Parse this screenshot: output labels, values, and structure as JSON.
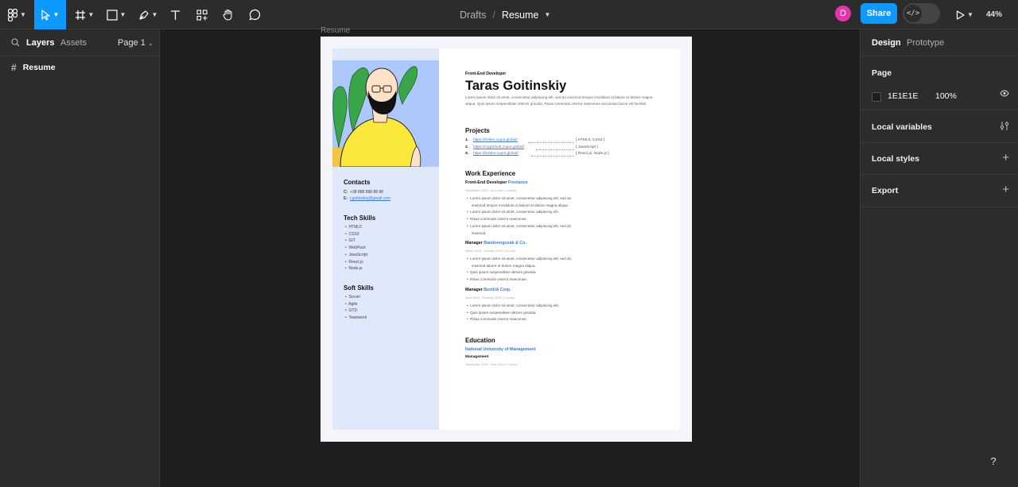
{
  "toolbar": {
    "breadcrumb_folder": "Drafts",
    "breadcrumb_sep": "/",
    "file_name": "Resume",
    "avatar_letter": "D",
    "share_label": "Share",
    "dev_mode_icon": "</>",
    "zoom": "44%"
  },
  "left_panel": {
    "tab_layers": "Layers",
    "tab_assets": "Assets",
    "page_selector": "Page 1",
    "layers": [
      {
        "name": "Resume",
        "icon": "frame-icon"
      }
    ]
  },
  "right_panel": {
    "tab_design": "Design",
    "tab_prototype": "Prototype",
    "page_heading": "Page",
    "page_color": "1E1E1E",
    "page_opacity": "100%",
    "local_variables": "Local variables",
    "local_styles": "Local styles",
    "export": "Export"
  },
  "canvas": {
    "frame_label": "Resume"
  },
  "resume": {
    "contacts": {
      "heading": "Contacts",
      "phone_label": "C:",
      "phone": "+38 888 888 88 88",
      "email_label": "E:",
      "email": "t.goitinskiy@gmail.com"
    },
    "tech_skills": {
      "heading": "Tech Skills",
      "items": [
        "HTML5",
        "CSS3",
        "GIT",
        "WebPack",
        "JavaScript",
        "React.js",
        "Node.js"
      ]
    },
    "soft_skills": {
      "heading": "Soft Skills",
      "items": [
        "Scrum",
        "Agile",
        "GTD",
        "Teamwork"
      ]
    },
    "role": "Front-End Developer",
    "name": "Taras Goitinskiy",
    "intro": "Lorem ipsum dolor sit amet, consectetur adipiscing elit, sed do eiusmod tempor incididunt ut labore et dolore magna aliqua. Quis ipsum suspendisse ultrices gravida. Risus commodo viverra maecenas accumsan lacus vel facilisis.",
    "projects": {
      "heading": "Projects",
      "items": [
        {
          "num": "1.",
          "url": "https://hellen.zupot.global/",
          "tech": "[ HTML5, CSS3 ]"
        },
        {
          "num": "2.",
          "url": "https://cryptohub.zupot.global/",
          "tech": "[ JavaScript ]"
        },
        {
          "num": "3.",
          "url": "https://kebike.zupot.global/",
          "tech": "[ React.js, Node.js ]"
        }
      ]
    },
    "work": {
      "heading": "Work Experience",
      "jobs": [
        {
          "title": "Front-End Developer",
          "company": "Freelance",
          "dates": "September 2019 - up to now   |   Country",
          "bullets": [
            "Lorem ipsum dolor sit amet, consectetur adipiscing elit, sed do",
            "eiusmod tempor incididunt ut labore et dolore magna aliqua.",
            "Lorem ipsum dolor sit amet, consectetur adipiscing elit.",
            "Risus commodo viverra maecenas.",
            "Lorem ipsum dolor sit amet, consectetur adipiscing elit, sed do",
            "eiusmod."
          ]
        },
        {
          "title": "Manager",
          "company": "Bandonogusak & Co.",
          "dates": "March 2018 - October 2019   |   Country",
          "bullets": [
            "Lorem ipsum dolor sit amet, consectetur adipiscing elit, sed do",
            "eiusmod labore et dolore magna aliqua.",
            "Quis ipsum suspendisse ultrices gravida.",
            "Risus commodo viverra maecenas."
          ]
        },
        {
          "title": "Manager",
          "company": "BestUA Corp.",
          "dates": "June 2014 - February 2018   |   Country",
          "bullets": [
            "Lorem ipsum dolor sit amet, consectetur adipiscing elit.",
            "Quis ipsum suspendisse ultrices gravida.",
            "Risus commodo viverra maecenas."
          ]
        }
      ]
    },
    "education": {
      "heading": "Education",
      "school": "National University of Management",
      "degree": "Management",
      "dates": "September 2009 - June 2014   |   Country"
    }
  }
}
